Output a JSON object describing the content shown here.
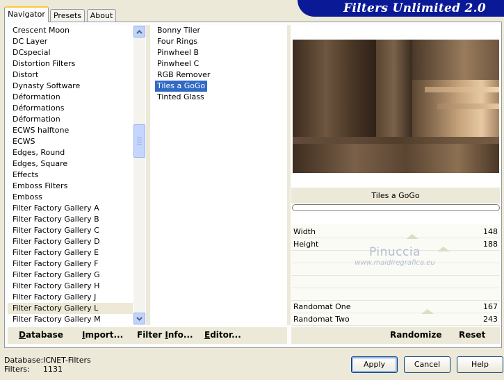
{
  "app": {
    "title": "Filters Unlimited 2.0"
  },
  "tabs": [
    {
      "label": "Navigator",
      "active": true
    },
    {
      "label": "Presets",
      "active": false
    },
    {
      "label": "About",
      "active": false
    }
  ],
  "categories": [
    "Crescent Moon",
    "DC Layer",
    "DCspecial",
    "Distortion Filters",
    "Distort",
    "Dynasty Software",
    "Déformation",
    "Déformations",
    "Déformation",
    "ECWS halftone",
    "ECWS",
    "Edges, Round",
    "Edges, Square",
    "Effects",
    "Emboss Filters",
    "Emboss",
    "Filter Factory Gallery A",
    "Filter Factory Gallery B",
    "Filter Factory Gallery C",
    "Filter Factory Gallery D",
    "Filter Factory Gallery E",
    "Filter Factory Gallery F",
    "Filter Factory Gallery G",
    "Filter Factory Gallery H",
    "Filter Factory Gallery J",
    "Filter Factory Gallery L",
    "Filter Factory Gallery M"
  ],
  "highlighted_category": "Filter Factory Gallery L",
  "filters": [
    "Bonny Tiler",
    "Four Rings",
    "Pinwheel B",
    "Pinwheel C",
    "RGB Remover",
    "Tiles a GoGo",
    "Tinted Glass"
  ],
  "selected_filter": "Tiles a GoGo",
  "preview": {
    "filter_name": "Tiles a GoGo"
  },
  "params": [
    {
      "name": "Width",
      "value": "148"
    },
    {
      "name": "Height",
      "value": "188"
    },
    {
      "name": "",
      "value": ""
    },
    {
      "name": "",
      "value": ""
    },
    {
      "name": "",
      "value": ""
    },
    {
      "name": "",
      "value": ""
    },
    {
      "name": "Randomat One",
      "value": "167"
    },
    {
      "name": "Randomat Two",
      "value": "243"
    }
  ],
  "watermark": {
    "line1": "Pinuccia",
    "line2": "www.maidiregrafica.eu"
  },
  "toolbar": {
    "database": {
      "key": "D",
      "rest": "atabase"
    },
    "import": {
      "key": "I",
      "rest": "mport..."
    },
    "filter_info": {
      "pre": "Filter ",
      "key": "I",
      "rest": "nfo..."
    },
    "editor": {
      "key": "E",
      "rest": "ditor..."
    },
    "randomize": "Randomize",
    "reset": "Reset"
  },
  "info": {
    "database_label": "Database:",
    "database_value": "ICNET-Filters",
    "filters_label": "Filters:",
    "filters_value": "1131"
  },
  "buttons": {
    "apply": "Apply",
    "cancel": "Cancel",
    "help": "Help"
  }
}
